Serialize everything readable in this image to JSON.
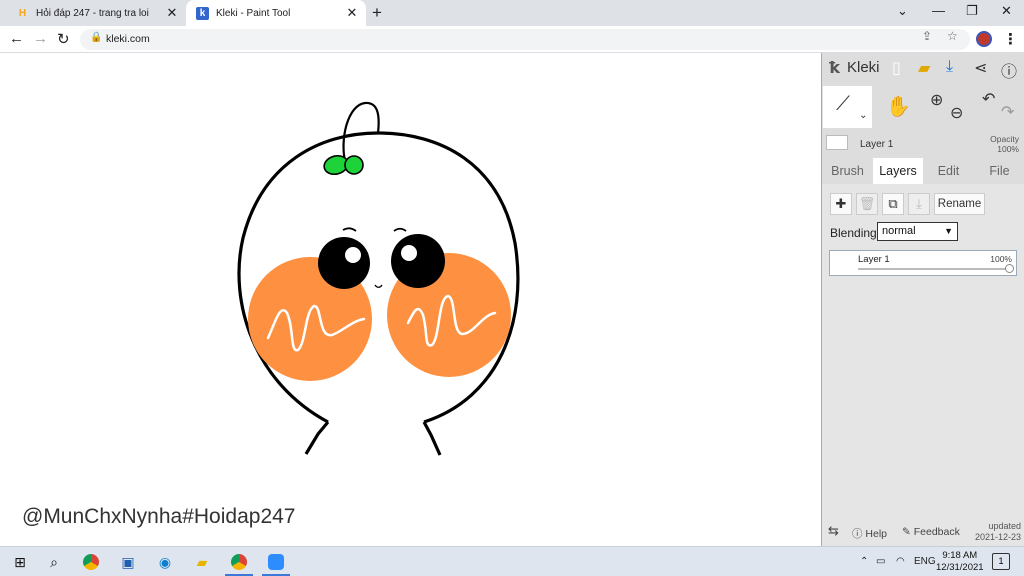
{
  "browser": {
    "tabs": [
      {
        "title": "Hỏi đáp 247 - trang tra loi",
        "icon": "hoidap-favicon",
        "active": false
      },
      {
        "title": "Kleki - Paint Tool",
        "icon": "kleki-favicon",
        "active": true
      }
    ],
    "close_glyph": "✕",
    "new_tab_glyph": "+",
    "url": "kleki.com",
    "window_controls": [
      "⌄",
      "—",
      "❐",
      "✕"
    ]
  },
  "canvas": {
    "watermark": "@MunChxNynha#Hoidap247",
    "colors": {
      "cheek": "#fd9141",
      "leaf": "#1ed33a",
      "outline": "#000000"
    }
  },
  "kleki": {
    "app_name": "Kleki",
    "layer_preview": {
      "name": "Layer 1",
      "opacity_label": "Opacity",
      "opacity_value": "100%"
    },
    "tabs": [
      {
        "label": "Brush",
        "active": false
      },
      {
        "label": "Layers",
        "active": true
      },
      {
        "label": "Edit",
        "active": false
      },
      {
        "label": "File",
        "active": false
      }
    ],
    "layer_buttons": {
      "rename": "Rename"
    },
    "blending": {
      "label": "Blending",
      "value": "normal"
    },
    "layers": [
      {
        "name": "Layer 1",
        "opacity": "100%",
        "opacity_fraction": 1.0
      }
    ],
    "footer": {
      "help": "Help",
      "feedback": "Feedback",
      "updated_label": "updated",
      "updated_date": "2021-12-23"
    }
  },
  "taskbar": {
    "language": "ENG",
    "time": "9:18 AM",
    "date": "12/31/2021",
    "notification_count": "1"
  }
}
